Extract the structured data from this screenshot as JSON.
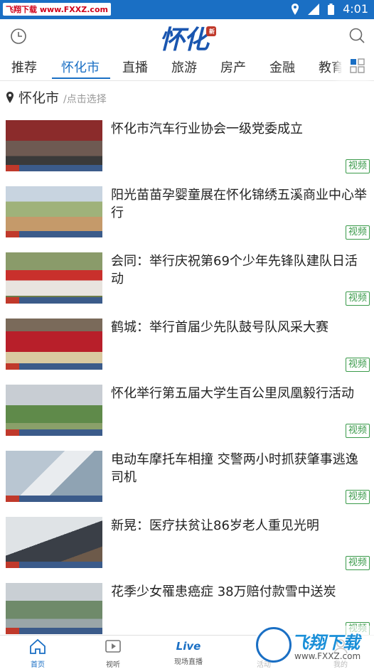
{
  "status_bar": {
    "watermark": "飞翔下载 www.FXXZ.com",
    "time": "4:01"
  },
  "header": {
    "logo_text": "怀化",
    "logo_seal": "新"
  },
  "tabs": [
    {
      "label": "推荐"
    },
    {
      "label": "怀化市"
    },
    {
      "label": "直播"
    },
    {
      "label": "旅游"
    },
    {
      "label": "房产"
    },
    {
      "label": "金融"
    },
    {
      "label": "教育"
    }
  ],
  "active_tab": "怀化市",
  "location": {
    "city": "怀化市",
    "hint": "/点击选择"
  },
  "news": [
    {
      "title": "怀化市汽车行业协会一级党委成立",
      "badge": "视频"
    },
    {
      "title": "阳光苗苗孕婴童展在怀化锦绣五溪商业中心举行",
      "badge": "视频"
    },
    {
      "title": "会同：举行庆祝第69个少年先锋队建队日活动",
      "badge": "视频"
    },
    {
      "title": "鹤城：举行首届少先队鼓号队风采大赛",
      "badge": "视频"
    },
    {
      "title": "怀化举行第五届大学生百公里凤凰毅行活动",
      "badge": "视频"
    },
    {
      "title": "电动车摩托车相撞 交警两小时抓获肇事逃逸司机",
      "badge": "视频"
    },
    {
      "title": "新晃：医疗扶贫让86岁老人重见光明",
      "badge": "视频"
    },
    {
      "title": "花季少女罹患癌症 38万赔付款雪中送炭",
      "badge": "视频"
    }
  ],
  "bottom_nav": [
    {
      "label": "首页"
    },
    {
      "label": "视听"
    },
    {
      "label": "现场直播",
      "icon_text": "Live"
    },
    {
      "label": "活动"
    },
    {
      "label": "我的"
    }
  ],
  "bottom_watermark": {
    "brand": "飞翔下载",
    "url": "www.FXXZ.com"
  },
  "colors": {
    "accent": "#1a6fc4",
    "badge": "#3a9a4a",
    "status_bar": "#1a6fc4"
  }
}
